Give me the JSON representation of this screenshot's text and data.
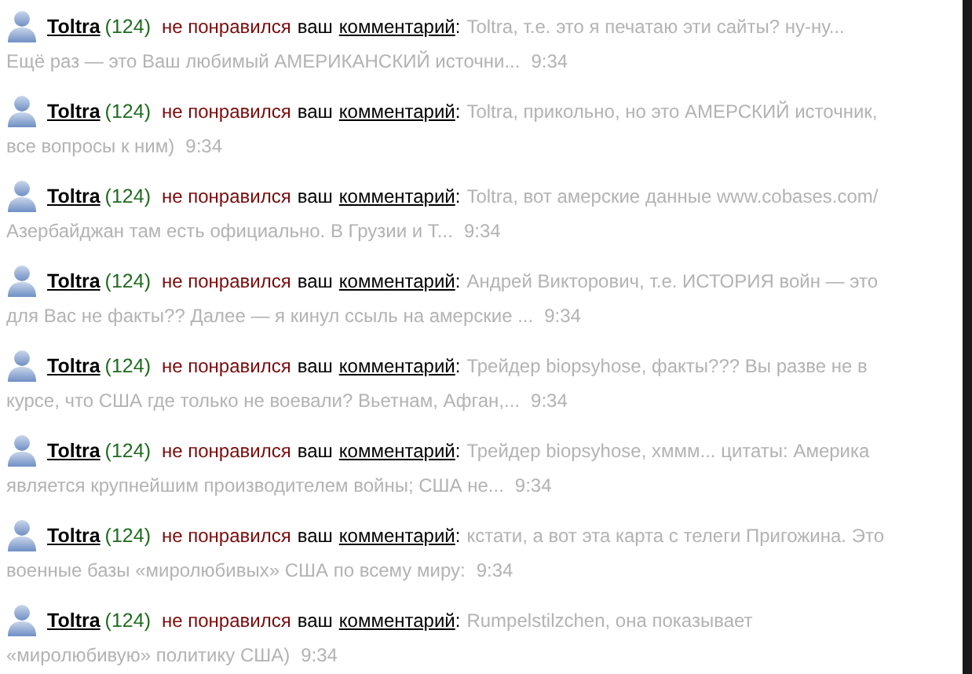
{
  "notifications": [
    {
      "user": "Toltra",
      "count": "(124)",
      "action": "не понравился",
      "possessive": "ваш",
      "object": "комментарий",
      "separator": ":",
      "text_line_1": "Toltra, т.е. это я печатаю эти сайты? ну-ну...",
      "text_line_2": "Ещё раз — это Ваш любимый АМЕРИКАНСКИЙ источни...",
      "time": "9:34"
    },
    {
      "user": "Toltra",
      "count": "(124)",
      "action": "не понравился",
      "possessive": "ваш",
      "object": "комментарий",
      "separator": ":",
      "text_line_1": "Toltra, прикольно, но это АМЕРСКИЙ источник,",
      "text_line_2": "все вопросы к ним)",
      "time": "9:34"
    },
    {
      "user": "Toltra",
      "count": "(124)",
      "action": "не понравился",
      "possessive": "ваш",
      "object": "комментарий",
      "separator": ":",
      "text_line_1": "Toltra, вот амерские данные www.cobases.com/",
      "text_line_2": "Азербайджан там есть официально. В Грузии и Т...",
      "time": "9:34"
    },
    {
      "user": "Toltra",
      "count": "(124)",
      "action": "не понравился",
      "possessive": "ваш",
      "object": "комментарий",
      "separator": ":",
      "text_line_1": "Андрей Викторович, т.е. ИСТОРИЯ войн — это",
      "text_line_2": "для Вас не факты?? Далее — я кинул ссыль на амерские ...",
      "time": "9:34"
    },
    {
      "user": "Toltra",
      "count": "(124)",
      "action": "не понравился",
      "possessive": "ваш",
      "object": "комментарий",
      "separator": ":",
      "text_line_1": "Трейдер biopsyhose, факты??? Вы разве не в",
      "text_line_2": "курсе, что США где только не воевали? Вьетнам, Афган,...",
      "time": "9:34"
    },
    {
      "user": "Toltra",
      "count": "(124)",
      "action": "не понравился",
      "possessive": "ваш",
      "object": "комментарий",
      "separator": ":",
      "text_line_1": "Трейдер biopsyhose, хммм... цитаты: Америка",
      "text_line_2": "является крупнейшим производителем войны; США не...",
      "time": "9:34"
    },
    {
      "user": "Toltra",
      "count": "(124)",
      "action": "не понравился",
      "possessive": "ваш",
      "object": "комментарий",
      "separator": ":",
      "text_line_1": "кстати, а вот эта карта с телеги Пригожина. Это",
      "text_line_2": "военные базы «миролюбивых» США по всему миру:",
      "time": "9:34"
    },
    {
      "user": "Toltra",
      "count": "(124)",
      "action": "не понравился",
      "possessive": "ваш",
      "object": "комментарий",
      "separator": ":",
      "text_line_1": "Rumpelstilzchen, она показывает",
      "text_line_2": "«миролюбивую» политику США)",
      "time": "9:34"
    }
  ]
}
